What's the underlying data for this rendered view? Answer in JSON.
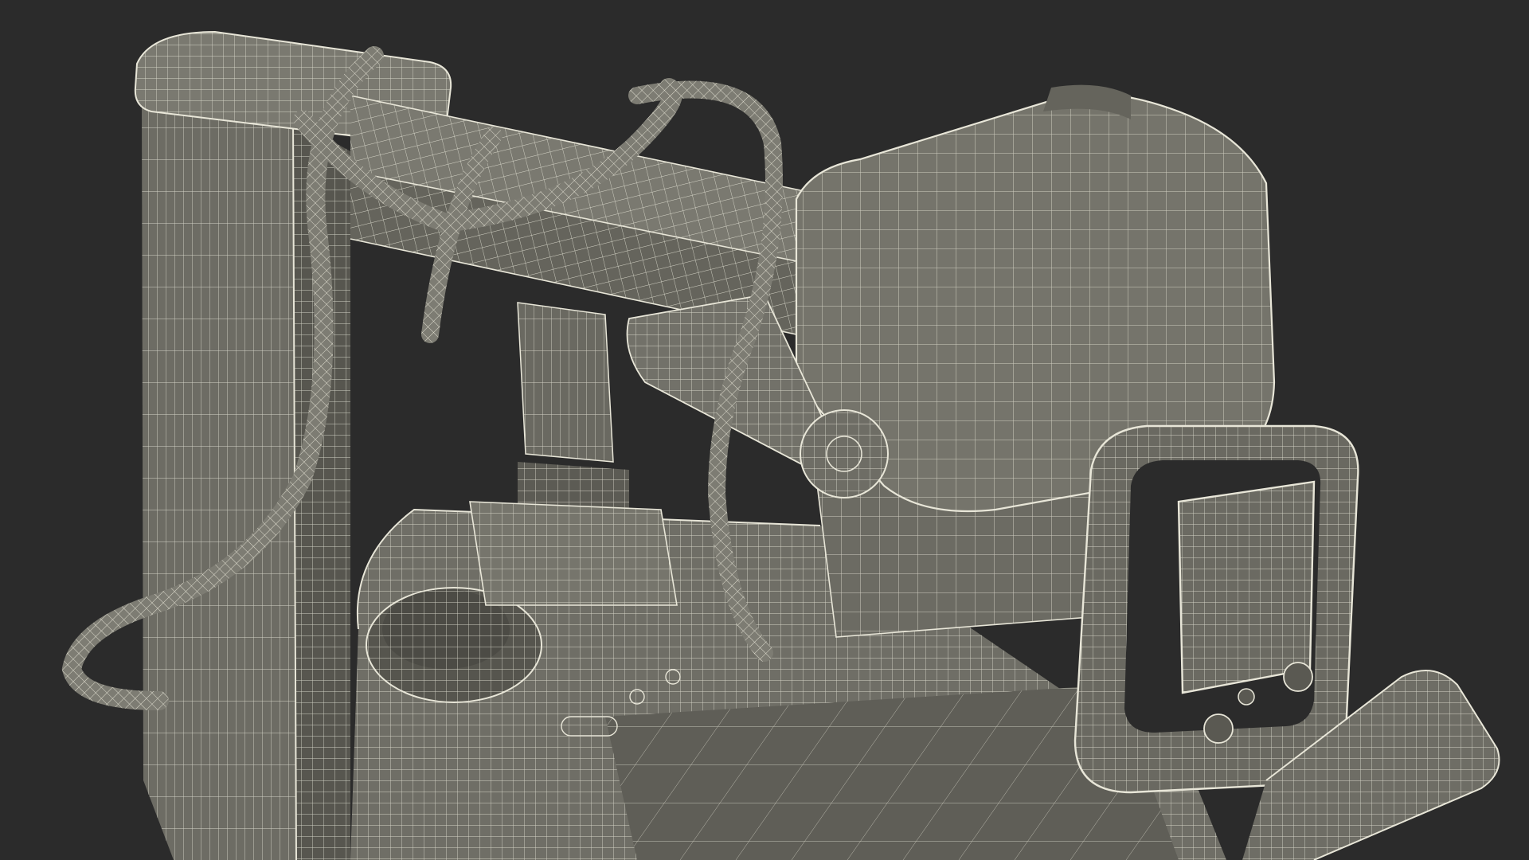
{
  "scene": {
    "subject": "wireframe-3d-model",
    "background_color": "#2b2b2b",
    "surface_color": "#6f6e66",
    "surface_dark_color": "#55544d",
    "surface_light_color": "#87867d",
    "wire_color": "#e8e6d8"
  }
}
